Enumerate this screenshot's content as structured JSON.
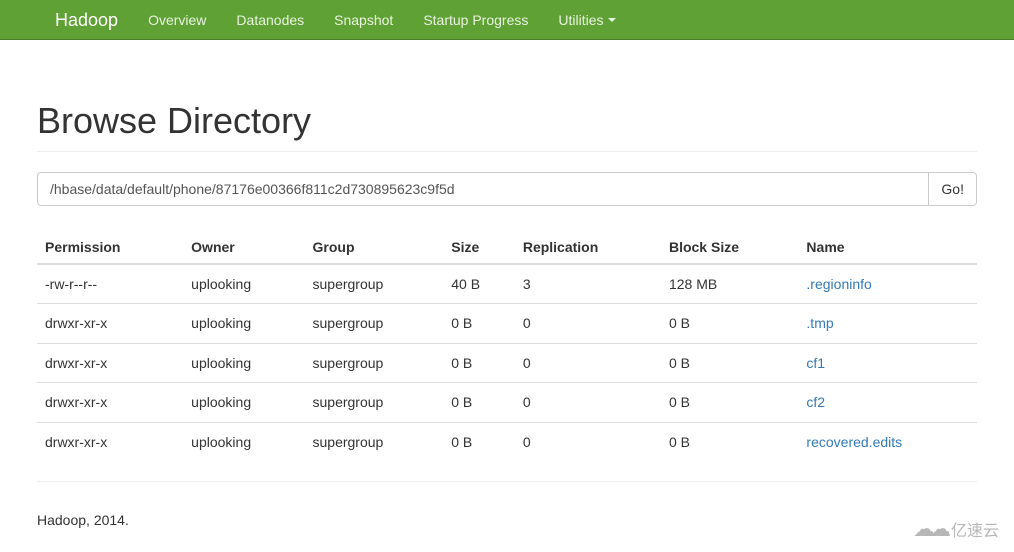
{
  "navbar": {
    "brand": "Hadoop",
    "items": [
      {
        "label": "Overview"
      },
      {
        "label": "Datanodes"
      },
      {
        "label": "Snapshot"
      },
      {
        "label": "Startup Progress"
      },
      {
        "label": "Utilities",
        "dropdown": true
      }
    ]
  },
  "page_title": "Browse Directory",
  "path_input": {
    "value": "/hbase/data/default/phone/87176e00366f811c2d730895623c9f5d"
  },
  "go_button": "Go!",
  "table": {
    "headers": [
      "Permission",
      "Owner",
      "Group",
      "Size",
      "Replication",
      "Block Size",
      "Name"
    ],
    "rows": [
      {
        "permission": "-rw-r--r--",
        "owner": "uplooking",
        "group": "supergroup",
        "size": "40 B",
        "replication": "3",
        "block_size": "128 MB",
        "name": ".regioninfo"
      },
      {
        "permission": "drwxr-xr-x",
        "owner": "uplooking",
        "group": "supergroup",
        "size": "0 B",
        "replication": "0",
        "block_size": "0 B",
        "name": ".tmp"
      },
      {
        "permission": "drwxr-xr-x",
        "owner": "uplooking",
        "group": "supergroup",
        "size": "0 B",
        "replication": "0",
        "block_size": "0 B",
        "name": "cf1"
      },
      {
        "permission": "drwxr-xr-x",
        "owner": "uplooking",
        "group": "supergroup",
        "size": "0 B",
        "replication": "0",
        "block_size": "0 B",
        "name": "cf2"
      },
      {
        "permission": "drwxr-xr-x",
        "owner": "uplooking",
        "group": "supergroup",
        "size": "0 B",
        "replication": "0",
        "block_size": "0 B",
        "name": "recovered.edits"
      }
    ]
  },
  "footer": "Hadoop, 2014.",
  "watermark": "亿速云"
}
